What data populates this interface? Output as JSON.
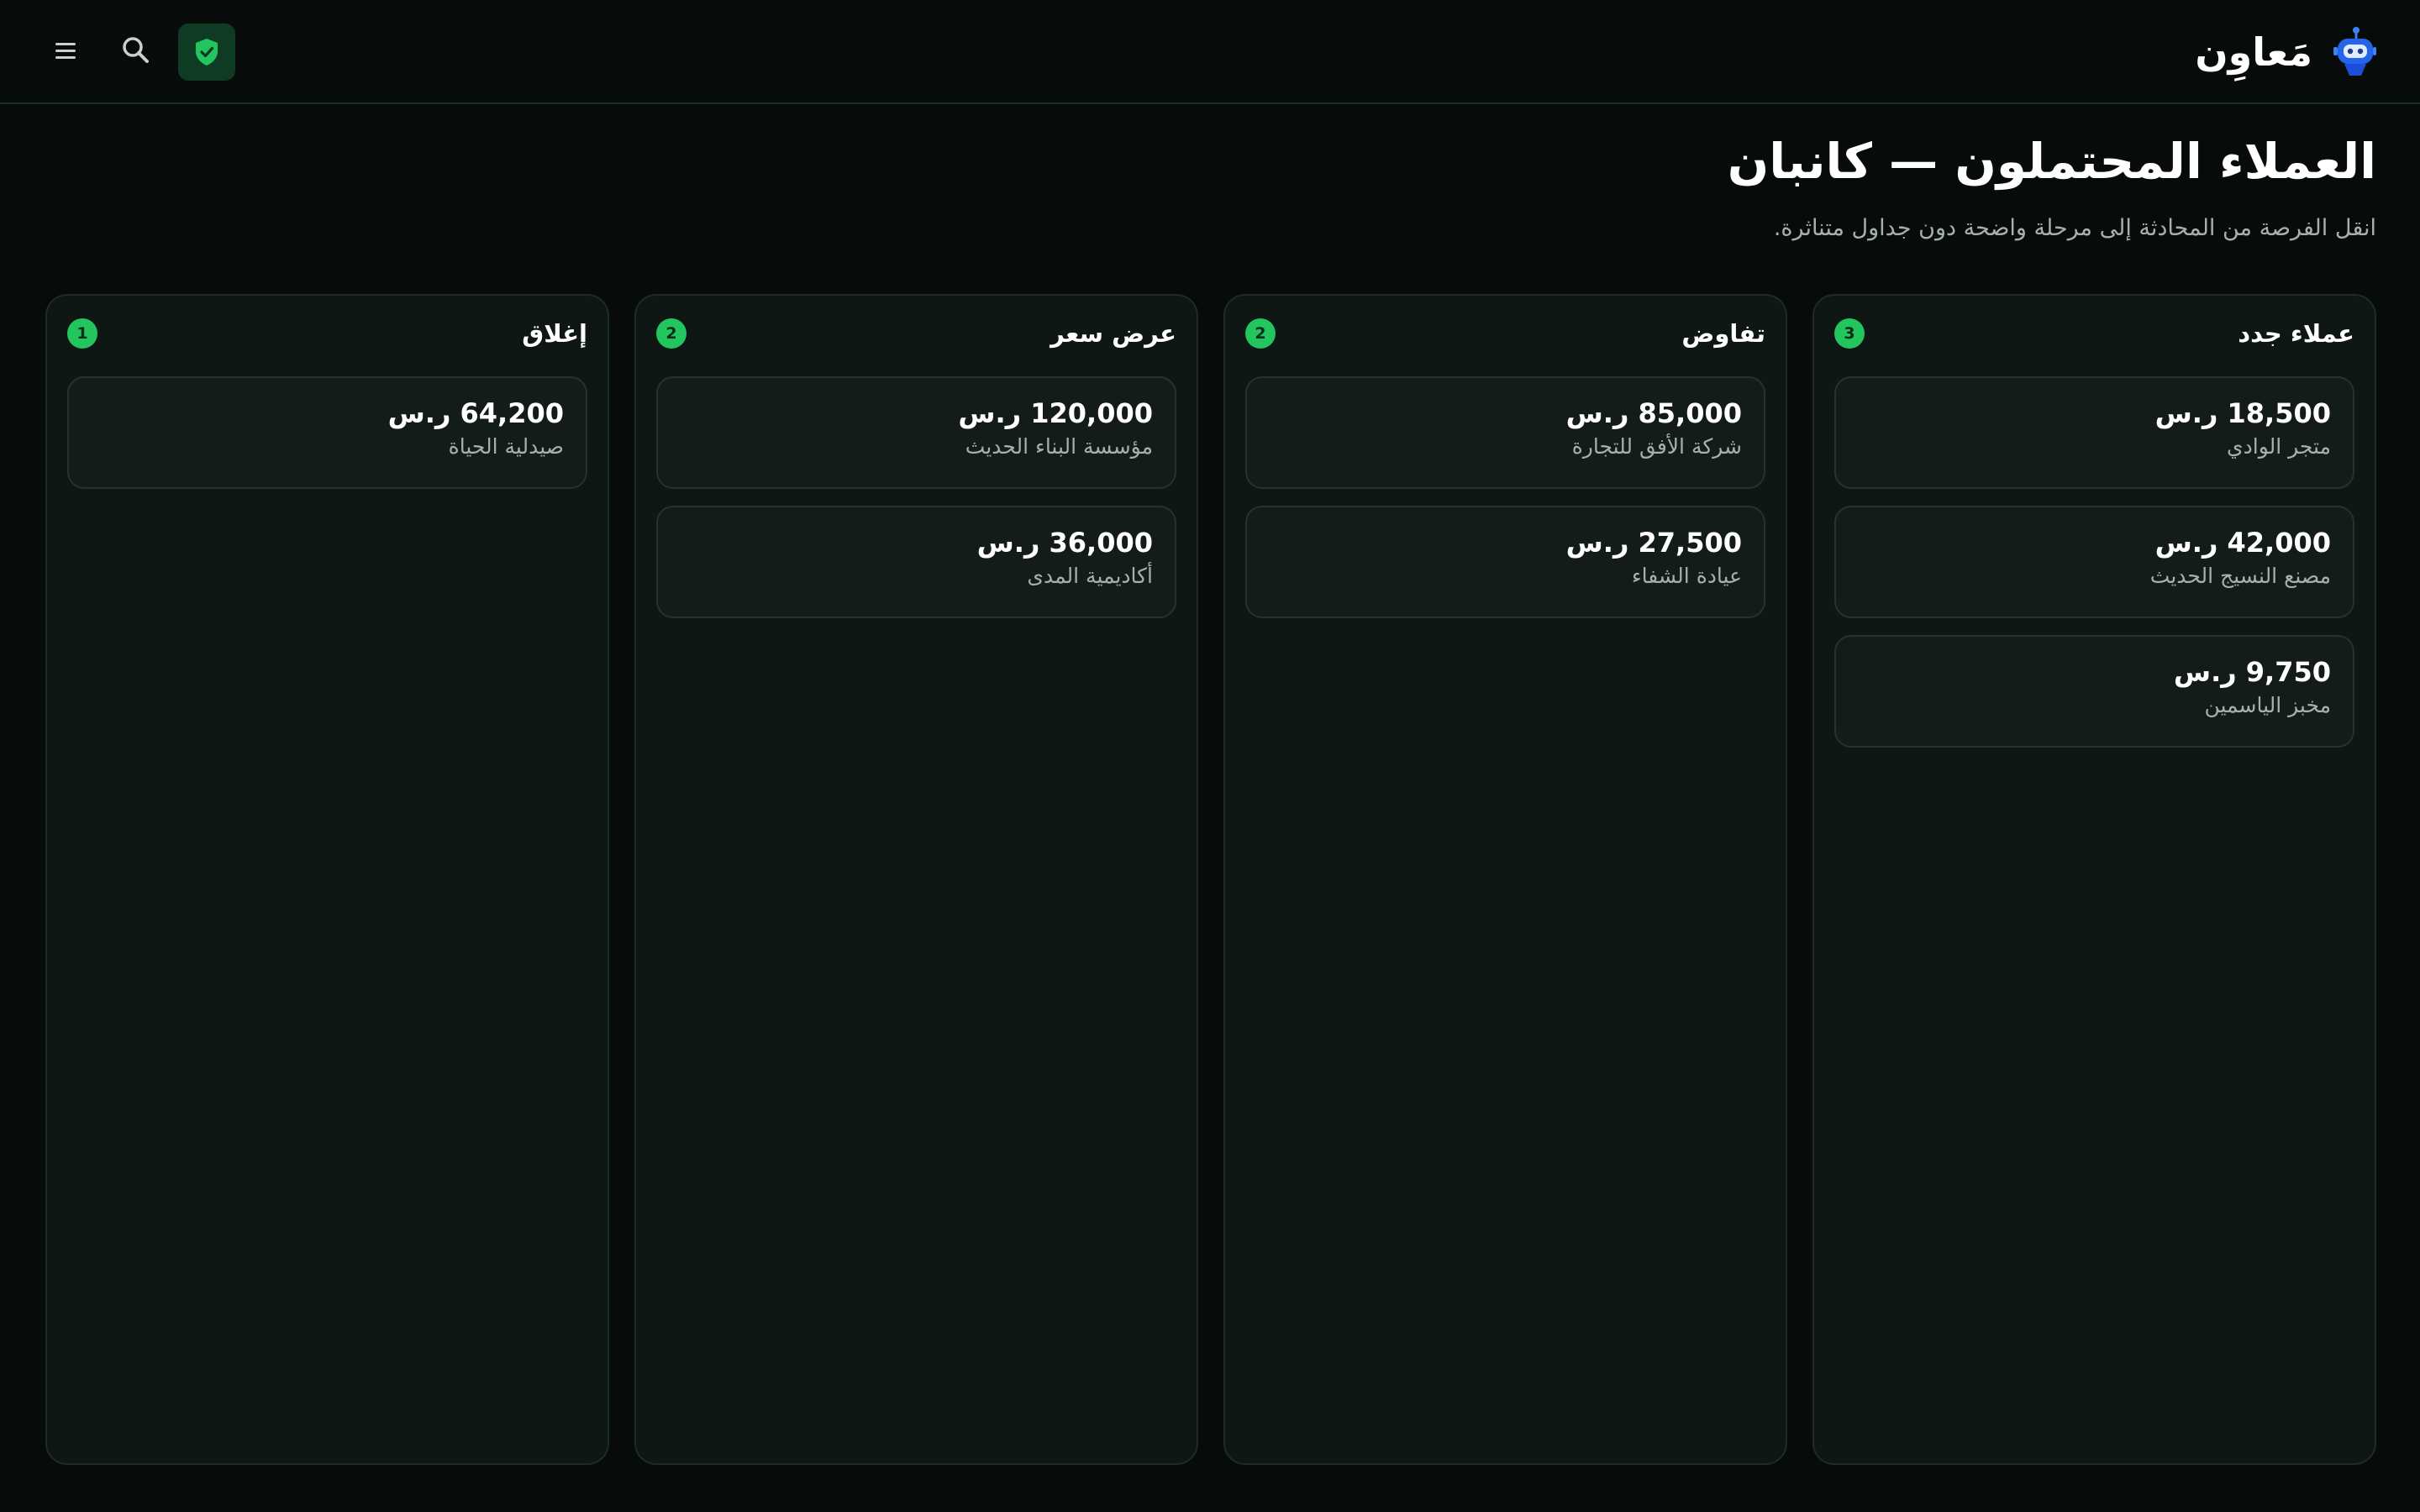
{
  "header": {
    "brand": "مَعاوِن",
    "icons": [
      "menu-icon",
      "search-icon",
      "shield-check-icon",
      "robot-logo"
    ],
    "accent": "#22c55e"
  },
  "page": {
    "title": "العملاء المحتملون — كانبان",
    "subtitle": "انقل الفرصة من المحادثة إلى مرحلة واضحة دون جداول متناثرة."
  },
  "columns": [
    {
      "title": "عملاء جدد",
      "count": "3",
      "cards": [
        {
          "amount": "18,500 ر.س",
          "name": "متجر الوادي"
        },
        {
          "amount": "42,000 ر.س",
          "name": "مصنع النسيج الحديث"
        },
        {
          "amount": "9,750 ر.س",
          "name": "مخبز الياسمين"
        }
      ]
    },
    {
      "title": "تفاوض",
      "count": "2",
      "cards": [
        {
          "amount": "85,000 ر.س",
          "name": "شركة الأفق للتجارة"
        },
        {
          "amount": "27,500 ر.س",
          "name": "عيادة الشفاء"
        }
      ]
    },
    {
      "title": "عرض سعر",
      "count": "2",
      "cards": [
        {
          "amount": "120,000 ر.س",
          "name": "مؤسسة البناء الحديث"
        },
        {
          "amount": "36,000 ر.س",
          "name": "أكاديمية المدى"
        }
      ]
    },
    {
      "title": "إغلاق",
      "count": "1",
      "cards": [
        {
          "amount": "64,200 ر.س",
          "name": "صيدلية الحياة"
        }
      ]
    }
  ]
}
